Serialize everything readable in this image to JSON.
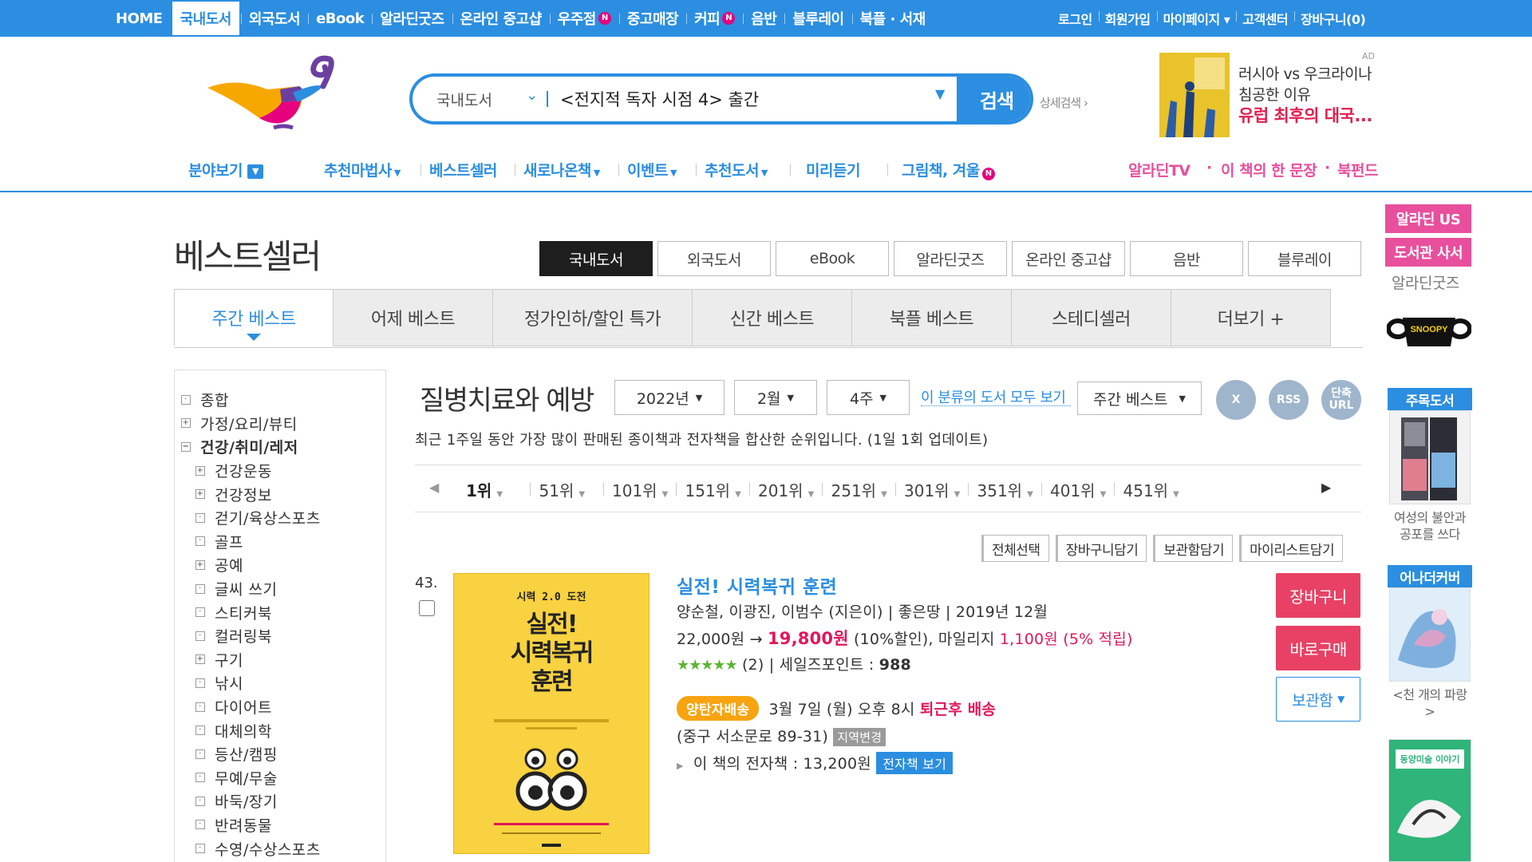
{
  "colors": {
    "primary": "#2b8ee0",
    "pink": "#e84f9c",
    "price_red": "#e0185a",
    "fast_ship": "#f7a410"
  },
  "topnav": {
    "items": [
      {
        "label": "HOME"
      },
      {
        "label": "국내도서",
        "active": true
      },
      {
        "label": "외국도서"
      },
      {
        "label": "eBook"
      },
      {
        "label": "알라딘굿즈"
      },
      {
        "label": "온라인 중고샵"
      },
      {
        "label": "우주점",
        "badge": "N"
      },
      {
        "label": "중고매장"
      },
      {
        "label": "커피",
        "badge": "N"
      },
      {
        "label": "음반"
      },
      {
        "label": "블루레이"
      },
      {
        "label": "북플 · 서재"
      }
    ],
    "util": [
      "로그인",
      "회원가입",
      "마이페이지 ▾",
      "고객센터",
      "장바구니(0)"
    ]
  },
  "search": {
    "category": "국내도서",
    "value": "<전지적 독자 시점 4> 출간",
    "button": "검색",
    "advanced": "상세검색 ›"
  },
  "ad": {
    "label": "AD",
    "line1": "러시아 vs 우크라이나",
    "line2": "침공한 이유",
    "line3": "유럽 최후의 대국..."
  },
  "catnav": {
    "browse": "분야보기",
    "items": [
      "추천마법사",
      "베스트셀러",
      "새로나온책",
      "이벤트",
      "추천도서",
      "미리듣기",
      "그림책, 겨울"
    ],
    "badge": "N",
    "right": [
      "알라딘TV",
      "이 책의 한 문장",
      "북펀드"
    ]
  },
  "rightside": {
    "btn_us": "알라딘 US",
    "btn_library": "도서관 사서",
    "goods": "알라딘굿즈",
    "mug_text": "SNOOPY",
    "box1": {
      "title": "주목도서",
      "caption": "여성의 불안과 공포를 쓰다"
    },
    "box2": {
      "title": "어나더커버",
      "caption": "<천 개의 파랑>"
    },
    "box3_cover": "동양미술 이야기"
  },
  "page": {
    "title": "베스트셀러",
    "type_tabs": [
      {
        "label": "국내도서",
        "active": true
      },
      {
        "label": "외국도서"
      },
      {
        "label": "eBook"
      },
      {
        "label": "알라딘굿즈"
      },
      {
        "label": "온라인 중고샵"
      },
      {
        "label": "음반"
      },
      {
        "label": "블루레이"
      }
    ],
    "main_tabs": [
      {
        "label": "주간 베스트",
        "active": true
      },
      {
        "label": "어제 베스트"
      },
      {
        "label": "정가인하/할인 특가"
      },
      {
        "label": "신간 베스트"
      },
      {
        "label": "북플 베스트"
      },
      {
        "label": "스테디셀러"
      },
      {
        "label": "더보기 +"
      }
    ]
  },
  "tree": [
    {
      "label": "종합",
      "box": "·",
      "level": 0
    },
    {
      "label": "가정/요리/뷰티",
      "box": "+",
      "level": 0
    },
    {
      "label": "건강/취미/레저",
      "box": "−",
      "level": 0,
      "open": true
    },
    {
      "label": "건강운동",
      "box": "+",
      "level": 1
    },
    {
      "label": "건강정보",
      "box": "+",
      "level": 1
    },
    {
      "label": "걷기/육상스포츠",
      "box": "·",
      "level": 1
    },
    {
      "label": "골프",
      "box": "·",
      "level": 1
    },
    {
      "label": "공예",
      "box": "+",
      "level": 1
    },
    {
      "label": "글씨 쓰기",
      "box": "·",
      "level": 1
    },
    {
      "label": "스티커북",
      "box": "·",
      "level": 1
    },
    {
      "label": "컬러링북",
      "box": "·",
      "level": 1
    },
    {
      "label": "구기",
      "box": "+",
      "level": 1
    },
    {
      "label": "낚시",
      "box": "·",
      "level": 1
    },
    {
      "label": "다이어트",
      "box": "·",
      "level": 1
    },
    {
      "label": "대체의학",
      "box": "·",
      "level": 1
    },
    {
      "label": "등산/캠핑",
      "box": "·",
      "level": 1
    },
    {
      "label": "무예/무술",
      "box": "·",
      "level": 1
    },
    {
      "label": "바둑/장기",
      "box": "·",
      "level": 1
    },
    {
      "label": "반려동물",
      "box": "·",
      "level": 1
    },
    {
      "label": "수영/수상스포츠",
      "box": "·",
      "level": 1
    }
  ],
  "content": {
    "category_title": "질병치료와 예방",
    "year": "2022년",
    "month": "2월",
    "week": "4주",
    "all_books_link": "이 분류의 도서 모두 보기",
    "best_select": "주간 베스트",
    "icons": {
      "excel": "X",
      "rss": "RSS",
      "short": "단축 URL"
    },
    "description": "최근 1주일 동안 가장 많이 판매된 종이책과 전자책을 합산한 순위입니다. (1일 1회 업데이트)",
    "ranks": [
      "1위",
      "51위",
      "101위",
      "151위",
      "201위",
      "251위",
      "301위",
      "351위",
      "401위",
      "451위"
    ],
    "actions": [
      "전체선택",
      "장바구니담기",
      "보관함담기",
      "마이리스트담기"
    ]
  },
  "book": {
    "rank": "43.",
    "cover_top": "시력 2.0 도전",
    "cover_title1": "실전!",
    "cover_title2": "시력복귀",
    "cover_title3": "훈련",
    "title": "실전! 시력복귀 훈련",
    "authors": "양순철, 이광진, 이범수 (지은이) | 좋은땅 | 2019년 12월",
    "price_list": "22,000원 →",
    "price_sale": "19,800원",
    "discount": "(10%할인), 마일리지",
    "mileage": "1,100원",
    "mileage_rate": "(5% 적립)",
    "stars": "★★★★★",
    "review_count": "(2) | 세일즈포인트 : ",
    "sales_point": "988",
    "fast_badge": "양탄자배송",
    "delivery": "3월 7일 (월) 오후 8시",
    "delivery_red": "퇴근후 배송",
    "address": "(중구 서소문로 89-31)",
    "address_btn": "지역변경",
    "ebook_text": "이 책의 전자책 : 13,200원",
    "ebook_btn": "전자책 보기",
    "btn_cart": "장바구니",
    "btn_buy": "바로구매",
    "btn_keep": "보관함"
  }
}
